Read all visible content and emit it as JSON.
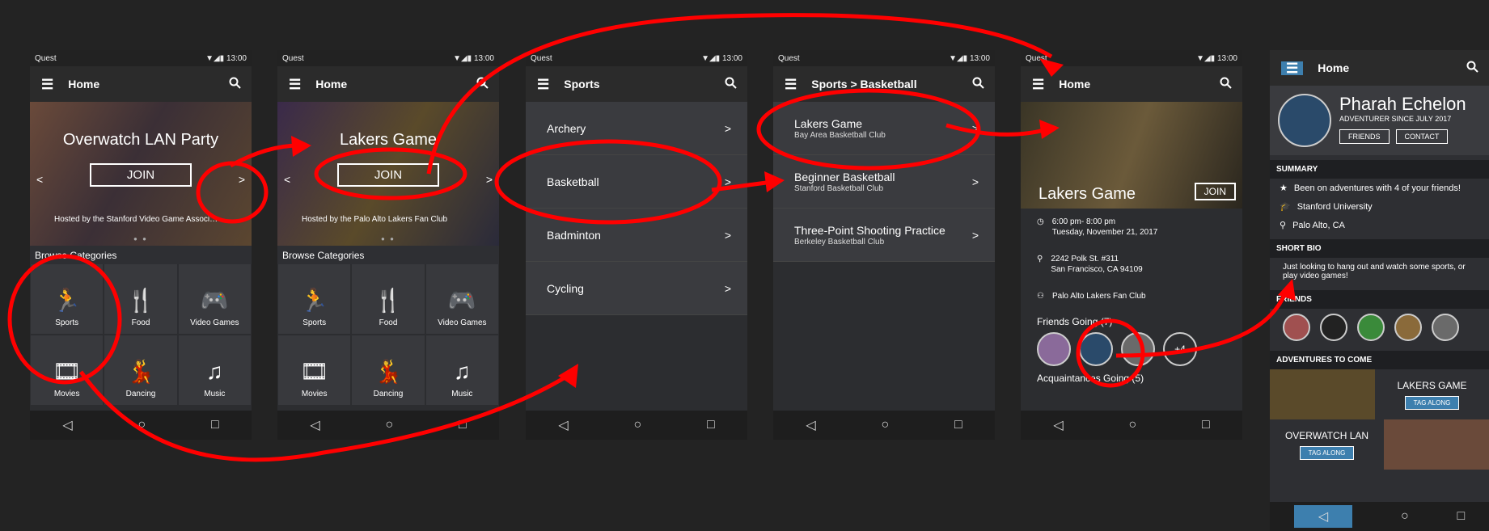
{
  "status": {
    "carrier": "Quest",
    "time": "13:00",
    "icons": "▼◢▮"
  },
  "nav": {
    "back": "◁",
    "home": "○",
    "recent": "□"
  },
  "screen1": {
    "title": "Home",
    "hero_title": "Overwatch LAN Party",
    "join": "JOIN",
    "hosted": "Hosted by the Stanford Video Game Associ…",
    "prev": "<",
    "next": ">",
    "dots": "● ●",
    "browse": "Browse Categories",
    "categories": [
      "Sports",
      "Food",
      "Video Games",
      "Movies",
      "Dancing",
      "Music"
    ]
  },
  "screen2": {
    "title": "Home",
    "hero_title": "Lakers Game",
    "join": "JOIN",
    "hosted": "Hosted by the Palo Alto Lakers Fan Club",
    "prev": "<",
    "next": ">",
    "dots": "● ●",
    "browse": "Browse Categories",
    "categories": [
      "Sports",
      "Food",
      "Video Games",
      "Movies",
      "Dancing",
      "Music"
    ]
  },
  "screen3": {
    "title": "Sports",
    "items": [
      "Archery",
      "Basketball",
      "Badminton",
      "Cycling"
    ],
    "chev": ">"
  },
  "screen4": {
    "title": "Sports > Basketball",
    "items": [
      {
        "name": "Lakers Game",
        "club": "Bay Area Basketball Club"
      },
      {
        "name": "Beginner Basketball",
        "club": "Stanford Basketball Club"
      },
      {
        "name": "Three-Point Shooting Practice",
        "club": "Berkeley Basketball Club"
      }
    ],
    "chev": ">"
  },
  "screen5": {
    "title": "Home",
    "event": "Lakers Game",
    "join": "JOIN",
    "time1": "6:00 pm- 8:00 pm",
    "time2": "Tuesday, November 21, 2017",
    "addr1": "2242 Polk St. #311",
    "addr2": "San Francisco, CA 94109",
    "host": "Palo Alto Lakers Fan Club",
    "friends": "Friends Going (7)",
    "plus": "+4",
    "acq": "Acquaintances Going (5)"
  },
  "screen6": {
    "title": "Home",
    "name": "Pharah Echelon",
    "since": "ADVENTURER SINCE JULY 2017",
    "friends_btn": "FRIENDS",
    "contact_btn": "CONTACT",
    "summary": "SUMMARY",
    "s1": "Been on adventures with 4 of your friends!",
    "s2": "Stanford University",
    "s3": "Palo Alto, CA",
    "bio_lbl": "SHORT BIO",
    "bio": "Just looking to hang out and watch some sports, or play video games!",
    "friends_lbl": "FRIENDS",
    "adv_lbl": "ADVENTURES TO COME",
    "adv1": "LAKERS GAME",
    "adv2": "OVERWATCH LAN",
    "tag": "TAG ALONG"
  },
  "colors": {
    "annotation": "#ff0000",
    "accent": "#3d7fae"
  }
}
